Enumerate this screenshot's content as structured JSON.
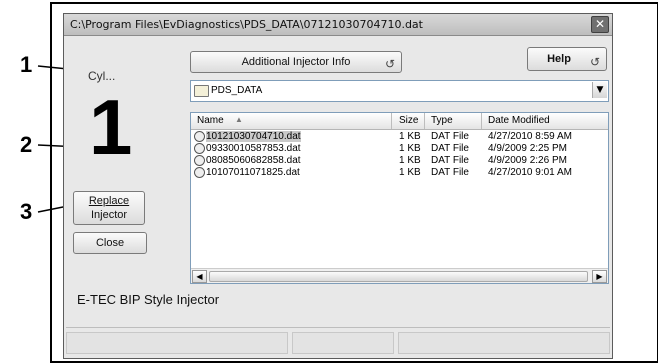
{
  "window": {
    "title": "C:\\Program Files\\EvDiagnostics\\PDS_DATA\\07121030704710.dat",
    "close_glyph": "✕"
  },
  "callouts": [
    "1",
    "2",
    "3"
  ],
  "cylinder": {
    "label": "Cyl...",
    "number": "1"
  },
  "buttons": {
    "additional_info": "Additional Injector Info",
    "help": "Help",
    "replace_line1": "Replace",
    "replace_line2": "Injector",
    "close": "Close"
  },
  "folder_combo": {
    "value": "PDS_DATA"
  },
  "file_list": {
    "columns": [
      "Name",
      "Size",
      "Type",
      "Date Modified"
    ],
    "rows": [
      {
        "name": "10121030704710.dat",
        "size": "1 KB",
        "type": "DAT File",
        "date": "4/27/2010 8:59 AM",
        "selected": true
      },
      {
        "name": "09330010587853.dat",
        "size": "1 KB",
        "type": "DAT File",
        "date": "4/9/2009 2:25 PM",
        "selected": false
      },
      {
        "name": "08085060682858.dat",
        "size": "1 KB",
        "type": "DAT File",
        "date": "4/9/2009 2:26 PM",
        "selected": false
      },
      {
        "name": "10107011071825.dat",
        "size": "1 KB",
        "type": "DAT File",
        "date": "4/27/2010 9:01 AM",
        "selected": false
      }
    ]
  },
  "footer_text": "E-TEC BIP Style Injector"
}
